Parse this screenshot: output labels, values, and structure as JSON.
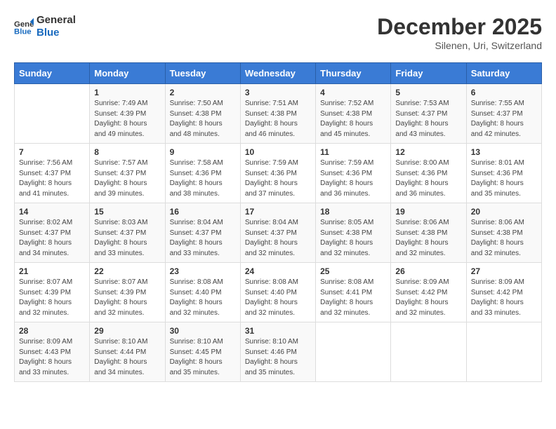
{
  "logo": {
    "text_general": "General",
    "text_blue": "Blue"
  },
  "header": {
    "month": "December 2025",
    "location": "Silenen, Uri, Switzerland"
  },
  "days_of_week": [
    "Sunday",
    "Monday",
    "Tuesday",
    "Wednesday",
    "Thursday",
    "Friday",
    "Saturday"
  ],
  "weeks": [
    [
      {
        "day": "",
        "info": ""
      },
      {
        "day": "1",
        "info": "Sunrise: 7:49 AM\nSunset: 4:39 PM\nDaylight: 8 hours\nand 49 minutes."
      },
      {
        "day": "2",
        "info": "Sunrise: 7:50 AM\nSunset: 4:38 PM\nDaylight: 8 hours\nand 48 minutes."
      },
      {
        "day": "3",
        "info": "Sunrise: 7:51 AM\nSunset: 4:38 PM\nDaylight: 8 hours\nand 46 minutes."
      },
      {
        "day": "4",
        "info": "Sunrise: 7:52 AM\nSunset: 4:38 PM\nDaylight: 8 hours\nand 45 minutes."
      },
      {
        "day": "5",
        "info": "Sunrise: 7:53 AM\nSunset: 4:37 PM\nDaylight: 8 hours\nand 43 minutes."
      },
      {
        "day": "6",
        "info": "Sunrise: 7:55 AM\nSunset: 4:37 PM\nDaylight: 8 hours\nand 42 minutes."
      }
    ],
    [
      {
        "day": "7",
        "info": "Sunrise: 7:56 AM\nSunset: 4:37 PM\nDaylight: 8 hours\nand 41 minutes."
      },
      {
        "day": "8",
        "info": "Sunrise: 7:57 AM\nSunset: 4:37 PM\nDaylight: 8 hours\nand 39 minutes."
      },
      {
        "day": "9",
        "info": "Sunrise: 7:58 AM\nSunset: 4:36 PM\nDaylight: 8 hours\nand 38 minutes."
      },
      {
        "day": "10",
        "info": "Sunrise: 7:59 AM\nSunset: 4:36 PM\nDaylight: 8 hours\nand 37 minutes."
      },
      {
        "day": "11",
        "info": "Sunrise: 7:59 AM\nSunset: 4:36 PM\nDaylight: 8 hours\nand 36 minutes."
      },
      {
        "day": "12",
        "info": "Sunrise: 8:00 AM\nSunset: 4:36 PM\nDaylight: 8 hours\nand 36 minutes."
      },
      {
        "day": "13",
        "info": "Sunrise: 8:01 AM\nSunset: 4:36 PM\nDaylight: 8 hours\nand 35 minutes."
      }
    ],
    [
      {
        "day": "14",
        "info": "Sunrise: 8:02 AM\nSunset: 4:37 PM\nDaylight: 8 hours\nand 34 minutes."
      },
      {
        "day": "15",
        "info": "Sunrise: 8:03 AM\nSunset: 4:37 PM\nDaylight: 8 hours\nand 33 minutes."
      },
      {
        "day": "16",
        "info": "Sunrise: 8:04 AM\nSunset: 4:37 PM\nDaylight: 8 hours\nand 33 minutes."
      },
      {
        "day": "17",
        "info": "Sunrise: 8:04 AM\nSunset: 4:37 PM\nDaylight: 8 hours\nand 32 minutes."
      },
      {
        "day": "18",
        "info": "Sunrise: 8:05 AM\nSunset: 4:38 PM\nDaylight: 8 hours\nand 32 minutes."
      },
      {
        "day": "19",
        "info": "Sunrise: 8:06 AM\nSunset: 4:38 PM\nDaylight: 8 hours\nand 32 minutes."
      },
      {
        "day": "20",
        "info": "Sunrise: 8:06 AM\nSunset: 4:38 PM\nDaylight: 8 hours\nand 32 minutes."
      }
    ],
    [
      {
        "day": "21",
        "info": "Sunrise: 8:07 AM\nSunset: 4:39 PM\nDaylight: 8 hours\nand 32 minutes."
      },
      {
        "day": "22",
        "info": "Sunrise: 8:07 AM\nSunset: 4:39 PM\nDaylight: 8 hours\nand 32 minutes."
      },
      {
        "day": "23",
        "info": "Sunrise: 8:08 AM\nSunset: 4:40 PM\nDaylight: 8 hours\nand 32 minutes."
      },
      {
        "day": "24",
        "info": "Sunrise: 8:08 AM\nSunset: 4:40 PM\nDaylight: 8 hours\nand 32 minutes."
      },
      {
        "day": "25",
        "info": "Sunrise: 8:08 AM\nSunset: 4:41 PM\nDaylight: 8 hours\nand 32 minutes."
      },
      {
        "day": "26",
        "info": "Sunrise: 8:09 AM\nSunset: 4:42 PM\nDaylight: 8 hours\nand 32 minutes."
      },
      {
        "day": "27",
        "info": "Sunrise: 8:09 AM\nSunset: 4:42 PM\nDaylight: 8 hours\nand 33 minutes."
      }
    ],
    [
      {
        "day": "28",
        "info": "Sunrise: 8:09 AM\nSunset: 4:43 PM\nDaylight: 8 hours\nand 33 minutes."
      },
      {
        "day": "29",
        "info": "Sunrise: 8:10 AM\nSunset: 4:44 PM\nDaylight: 8 hours\nand 34 minutes."
      },
      {
        "day": "30",
        "info": "Sunrise: 8:10 AM\nSunset: 4:45 PM\nDaylight: 8 hours\nand 35 minutes."
      },
      {
        "day": "31",
        "info": "Sunrise: 8:10 AM\nSunset: 4:46 PM\nDaylight: 8 hours\nand 35 minutes."
      },
      {
        "day": "",
        "info": ""
      },
      {
        "day": "",
        "info": ""
      },
      {
        "day": "",
        "info": ""
      }
    ]
  ]
}
